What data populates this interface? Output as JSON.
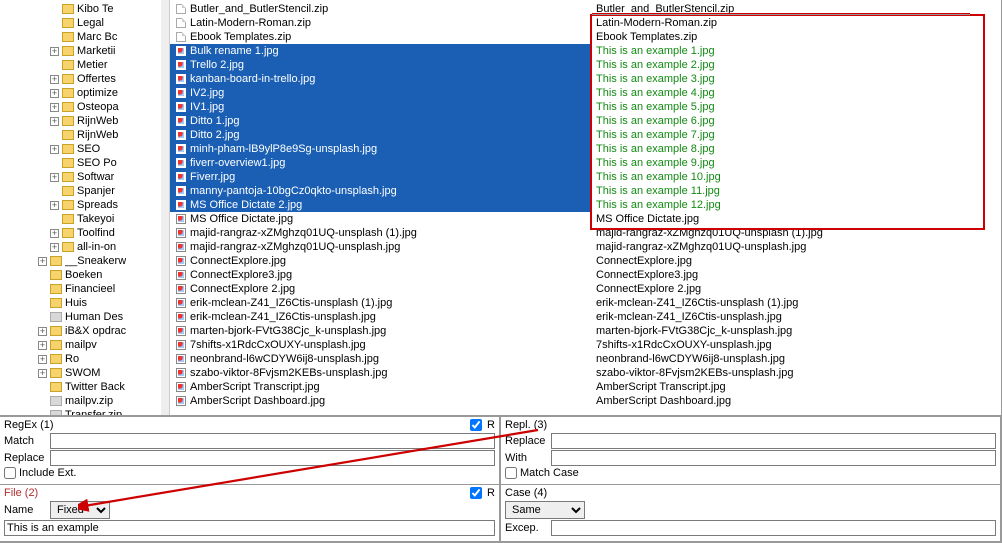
{
  "tree": {
    "items": [
      {
        "indent": 4,
        "expander": "",
        "icon": "folder",
        "label": "Kibo Te"
      },
      {
        "indent": 4,
        "expander": "",
        "icon": "folder",
        "label": "Legal"
      },
      {
        "indent": 4,
        "expander": "",
        "icon": "folder",
        "label": "Marc Bc"
      },
      {
        "indent": 4,
        "expander": "+",
        "icon": "folder",
        "label": "Marketii"
      },
      {
        "indent": 4,
        "expander": "",
        "icon": "folder",
        "label": "Metier"
      },
      {
        "indent": 4,
        "expander": "+",
        "icon": "folder",
        "label": "Offertes"
      },
      {
        "indent": 4,
        "expander": "+",
        "icon": "folder",
        "label": "optimize"
      },
      {
        "indent": 4,
        "expander": "+",
        "icon": "folder",
        "label": "Osteopa"
      },
      {
        "indent": 4,
        "expander": "+",
        "icon": "folder",
        "label": "RijnWeb"
      },
      {
        "indent": 4,
        "expander": "",
        "icon": "folder",
        "label": "RijnWeb"
      },
      {
        "indent": 4,
        "expander": "+",
        "icon": "folder",
        "label": "SEO"
      },
      {
        "indent": 4,
        "expander": "",
        "icon": "folder",
        "label": "SEO Po"
      },
      {
        "indent": 4,
        "expander": "+",
        "icon": "folder",
        "label": "Softwar"
      },
      {
        "indent": 4,
        "expander": "",
        "icon": "folder",
        "label": "Spanjer"
      },
      {
        "indent": 4,
        "expander": "+",
        "icon": "folder",
        "label": "Spreads"
      },
      {
        "indent": 4,
        "expander": "",
        "icon": "folder",
        "label": "Takeyoi"
      },
      {
        "indent": 4,
        "expander": "+",
        "icon": "folder",
        "label": "Toolfind"
      },
      {
        "indent": 4,
        "expander": "+",
        "icon": "folder",
        "label": "all-in-on"
      },
      {
        "indent": 3,
        "expander": "+",
        "icon": "folder",
        "label": "__Sneakerw"
      },
      {
        "indent": 3,
        "expander": "",
        "icon": "folder",
        "label": "Boeken"
      },
      {
        "indent": 3,
        "expander": "",
        "icon": "folder",
        "label": "Financieel"
      },
      {
        "indent": 3,
        "expander": "",
        "icon": "folder",
        "label": "Huis"
      },
      {
        "indent": 3,
        "expander": "",
        "icon": "folder-grey",
        "label": "Human Des"
      },
      {
        "indent": 3,
        "expander": "+",
        "icon": "folder",
        "label": "iB&X opdrac"
      },
      {
        "indent": 3,
        "expander": "+",
        "icon": "folder",
        "label": "mailpv"
      },
      {
        "indent": 3,
        "expander": "+",
        "icon": "folder",
        "label": "Ro"
      },
      {
        "indent": 3,
        "expander": "+",
        "icon": "folder",
        "label": "SWOM"
      },
      {
        "indent": 3,
        "expander": "",
        "icon": "folder",
        "label": "Twitter Back"
      },
      {
        "indent": 3,
        "expander": "",
        "icon": "folder-grey",
        "label": "mailpv.zip"
      },
      {
        "indent": 3,
        "expander": "",
        "icon": "folder-grey",
        "label": "Transfer.zip"
      }
    ]
  },
  "left_list": [
    {
      "t": "zip",
      "sel": false,
      "label": "Butler_and_ButlerStencil.zip"
    },
    {
      "t": "zip",
      "sel": false,
      "label": "Latin-Modern-Roman.zip"
    },
    {
      "t": "zip",
      "sel": false,
      "label": "Ebook Templates.zip"
    },
    {
      "t": "img",
      "sel": true,
      "label": "Bulk rename 1.jpg"
    },
    {
      "t": "img",
      "sel": true,
      "label": "Trello 2.jpg"
    },
    {
      "t": "img",
      "sel": true,
      "label": "kanban-board-in-trello.jpg"
    },
    {
      "t": "img",
      "sel": true,
      "label": "IV2.jpg"
    },
    {
      "t": "img",
      "sel": true,
      "label": "IV1.jpg"
    },
    {
      "t": "img",
      "sel": true,
      "label": "Ditto 1.jpg"
    },
    {
      "t": "img",
      "sel": true,
      "label": "Ditto 2.jpg"
    },
    {
      "t": "img",
      "sel": true,
      "label": "minh-pham-lB9ylP8e9Sg-unsplash.jpg"
    },
    {
      "t": "img",
      "sel": true,
      "label": "fiverr-overview1.jpg"
    },
    {
      "t": "img",
      "sel": true,
      "label": "Fiverr.jpg"
    },
    {
      "t": "img",
      "sel": true,
      "label": "manny-pantoja-10bgCz0qkto-unsplash.jpg"
    },
    {
      "t": "img",
      "sel": true,
      "label": "MS Office Dictate 2.jpg"
    },
    {
      "t": "img",
      "sel": false,
      "label": "MS Office Dictate.jpg"
    },
    {
      "t": "img",
      "sel": false,
      "label": "majid-rangraz-xZMghzq01UQ-unsplash (1).jpg"
    },
    {
      "t": "img",
      "sel": false,
      "label": "majid-rangraz-xZMghzq01UQ-unsplash.jpg"
    },
    {
      "t": "img",
      "sel": false,
      "label": "ConnectExplore.jpg"
    },
    {
      "t": "img",
      "sel": false,
      "label": "ConnectExplore3.jpg"
    },
    {
      "t": "img",
      "sel": false,
      "label": "ConnectExplore 2.jpg"
    },
    {
      "t": "img",
      "sel": false,
      "label": "erik-mclean-Z41_IZ6Ctis-unsplash (1).jpg"
    },
    {
      "t": "img",
      "sel": false,
      "label": "erik-mclean-Z41_IZ6Ctis-unsplash.jpg"
    },
    {
      "t": "img",
      "sel": false,
      "label": "marten-bjork-FVtG38Cjc_k-unsplash.jpg"
    },
    {
      "t": "img",
      "sel": false,
      "label": "7shifts-x1RdcCxOUXY-unsplash.jpg"
    },
    {
      "t": "img",
      "sel": false,
      "label": "neonbrand-l6wCDYW6ij8-unsplash.jpg"
    },
    {
      "t": "img",
      "sel": false,
      "label": "szabo-viktor-8Fvjsm2KEBs-unsplash.jpg"
    },
    {
      "t": "img",
      "sel": false,
      "label": "AmberScript Transcript.jpg"
    },
    {
      "t": "img",
      "sel": false,
      "label": "AmberScript Dashboard.jpg"
    }
  ],
  "right_list": [
    {
      "cls": "",
      "label": "Butler_and_ButlerStencil.zip"
    },
    {
      "cls": "",
      "label": "Latin-Modern-Roman.zip"
    },
    {
      "cls": "",
      "label": "Ebook Templates.zip"
    },
    {
      "cls": "preview",
      "label": "This is an example 1.jpg"
    },
    {
      "cls": "preview",
      "label": "This is an example 2.jpg"
    },
    {
      "cls": "preview",
      "label": "This is an example 3.jpg"
    },
    {
      "cls": "preview",
      "label": "This is an example 4.jpg"
    },
    {
      "cls": "preview",
      "label": "This is an example 5.jpg"
    },
    {
      "cls": "preview",
      "label": "This is an example 6.jpg"
    },
    {
      "cls": "preview",
      "label": "This is an example 7.jpg"
    },
    {
      "cls": "preview",
      "label": "This is an example 8.jpg"
    },
    {
      "cls": "preview",
      "label": "This is an example 9.jpg"
    },
    {
      "cls": "preview",
      "label": "This is an example 10.jpg"
    },
    {
      "cls": "preview",
      "label": "This is an example 11.jpg"
    },
    {
      "cls": "preview",
      "label": "This is an example 12.jpg"
    },
    {
      "cls": "",
      "label": "MS Office Dictate.jpg"
    },
    {
      "cls": "",
      "label": "majid-rangraz-xZMghzq01UQ-unsplash (1).jpg"
    },
    {
      "cls": "",
      "label": "majid-rangraz-xZMghzq01UQ-unsplash.jpg"
    },
    {
      "cls": "",
      "label": "ConnectExplore.jpg"
    },
    {
      "cls": "",
      "label": "ConnectExplore3.jpg"
    },
    {
      "cls": "",
      "label": "ConnectExplore 2.jpg"
    },
    {
      "cls": "",
      "label": "erik-mclean-Z41_IZ6Ctis-unsplash (1).jpg"
    },
    {
      "cls": "",
      "label": "erik-mclean-Z41_IZ6Ctis-unsplash.jpg"
    },
    {
      "cls": "",
      "label": "marten-bjork-FVtG38Cjc_k-unsplash.jpg"
    },
    {
      "cls": "",
      "label": "7shifts-x1RdcCxOUXY-unsplash.jpg"
    },
    {
      "cls": "",
      "label": "neonbrand-l6wCDYW6ij8-unsplash.jpg"
    },
    {
      "cls": "",
      "label": "szabo-viktor-8Fvjsm2KEBs-unsplash.jpg"
    },
    {
      "cls": "",
      "label": "AmberScript Transcript.jpg"
    },
    {
      "cls": "",
      "label": "AmberScript Dashboard.jpg"
    }
  ],
  "panels": {
    "regex": {
      "title": "RegEx (1)",
      "match": "Match",
      "replace": "Replace",
      "include_ext": "Include Ext.",
      "r": "R"
    },
    "repl": {
      "title": "Repl. (3)",
      "replace": "Replace",
      "with": "With",
      "match_case": "Match Case"
    },
    "file": {
      "title": "File (2)",
      "name": "Name",
      "mode": "Fixed",
      "value": "This is an example",
      "r": "R"
    },
    "case": {
      "title": "Case (4)",
      "mode": "Same",
      "excep": "Excep."
    }
  }
}
